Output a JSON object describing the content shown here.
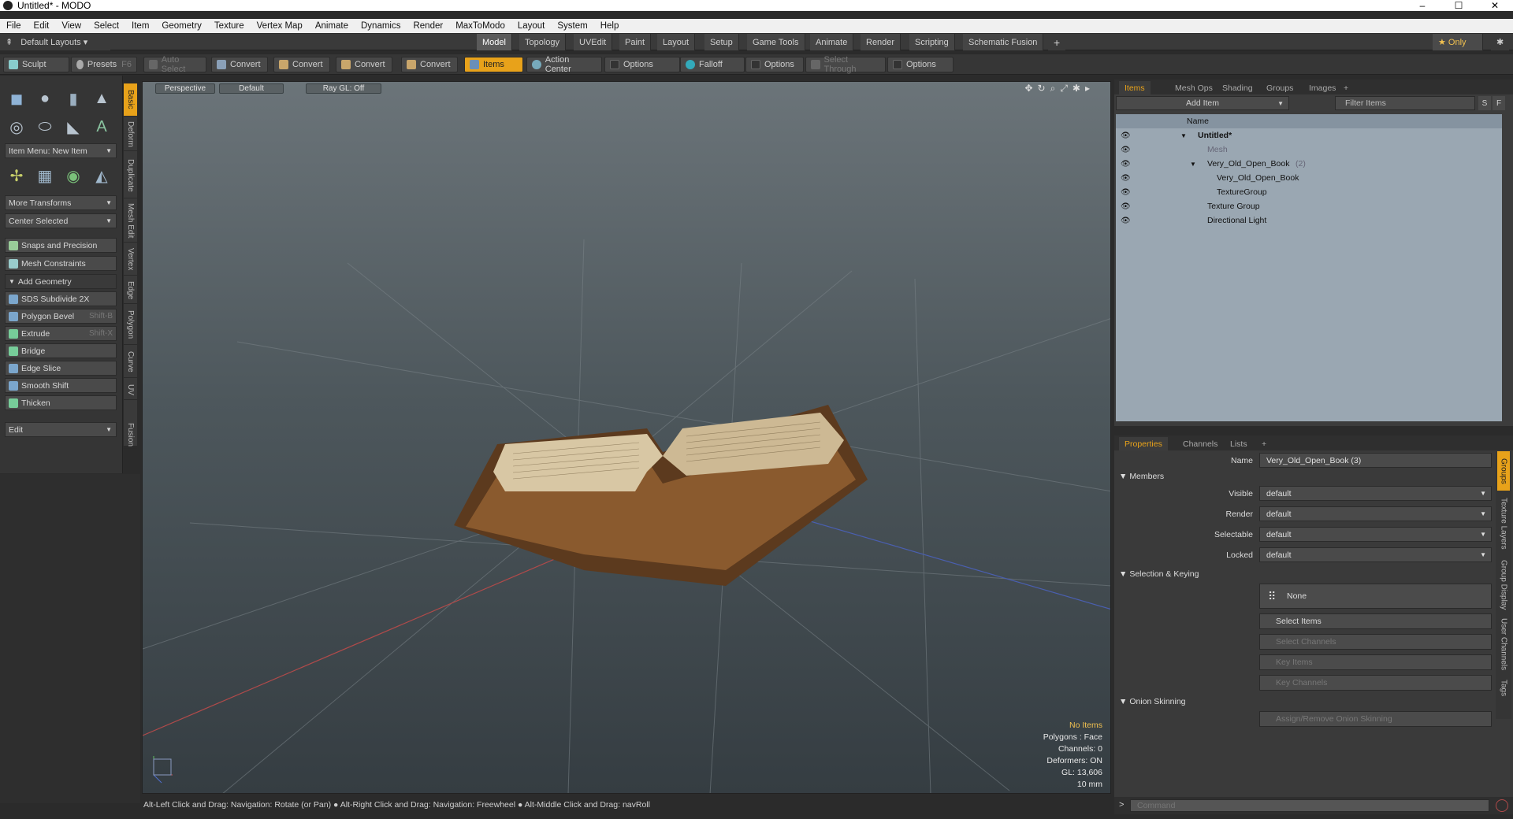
{
  "window": {
    "title": "Untitled* - MODO",
    "minimize": "–",
    "maximize": "☐",
    "close": "✕"
  },
  "menu": [
    "File",
    "Edit",
    "View",
    "Select",
    "Item",
    "Geometry",
    "Texture",
    "Vertex Map",
    "Animate",
    "Dynamics",
    "Render",
    "MaxToModo",
    "Layout",
    "System",
    "Help"
  ],
  "layoutbar": {
    "layouts": "Default Layouts ▾",
    "tabs": [
      "Model",
      "Topology",
      "UVEdit",
      "Paint",
      "Layout",
      "Setup",
      "Game Tools",
      "Animate",
      "Render",
      "Scripting",
      "Schematic Fusion"
    ],
    "active": "Model",
    "plus": "+",
    "only": "★ Only",
    "gear": "✱"
  },
  "toolbar": {
    "sculpt": "Sculpt",
    "presets": "Presets",
    "presets_key": "F6",
    "auto_select": "Auto Select",
    "convert": "Convert",
    "items": "Items",
    "action_center": "Action Center",
    "options": "Options",
    "falloff": "Falloff",
    "select_through": "Select Through"
  },
  "left": {
    "item_menu": "Item Menu: New Item",
    "more_transforms": "More Transforms",
    "center_selected": "Center Selected",
    "snaps": "Snaps and Precision",
    "mesh_constraints": "Mesh Constraints",
    "add_geometry": "Add Geometry",
    "sds": "SDS Subdivide 2X",
    "polygon_bevel": "Polygon Bevel",
    "polygon_bevel_key": "Shift-B",
    "extrude": "Extrude",
    "extrude_key": "Shift-X",
    "bridge": "Bridge",
    "edge_slice": "Edge Slice",
    "smooth_shift": "Smooth Shift",
    "thicken": "Thicken",
    "edit": "Edit"
  },
  "vtabs": [
    "Basic",
    "Deform",
    "Duplicate",
    "Mesh Edit",
    "Vertex",
    "Edge",
    "Polygon",
    "Curve",
    "UV",
    "Fusion"
  ],
  "viewport": {
    "perspective": "Perspective",
    "default": "Default",
    "raygl": "Ray GL: Off"
  },
  "stats": {
    "no_items": "No Items",
    "polygons": "Polygons : Face",
    "channels": "Channels: 0",
    "deformers": "Deformers: ON",
    "gl": "GL: 13,606",
    "scale": "10 mm"
  },
  "statusbar": "Alt-Left Click and Drag: Navigation: Rotate (or Pan) ● Alt-Right Click and Drag: Navigation: Freewheel ● Alt-Middle Click and Drag: navRoll",
  "items_panel": {
    "tabs": [
      "Items",
      "Mesh Ops",
      "Shading",
      "Groups",
      "Images"
    ],
    "add_item": "Add Item",
    "filter": "Filter Items",
    "s": "S",
    "f": "F",
    "name_header": "Name",
    "tree": [
      {
        "label": "Untitled*",
        "level": 0,
        "bold": true
      },
      {
        "label": "Mesh",
        "level": 1,
        "dim": true
      },
      {
        "label": "Very_Old_Open_Book",
        "suffix": "(2)",
        "level": 1
      },
      {
        "label": "Very_Old_Open_Book",
        "level": 2
      },
      {
        "label": "TextureGroup",
        "level": 2
      },
      {
        "label": "Texture Group",
        "level": 1
      },
      {
        "label": "Directional Light",
        "level": 1
      }
    ]
  },
  "props": {
    "tabs": [
      "Properties",
      "Channels",
      "Lists"
    ],
    "name_label": "Name",
    "name_value": "Very_Old_Open_Book (3)",
    "members": "Members",
    "visible": "Visible",
    "render": "Render",
    "selectable": "Selectable",
    "locked": "Locked",
    "default": "default",
    "selection_keying": "Selection & Keying",
    "none": "None",
    "select_items": "Select Items",
    "select_channels": "Select Channels",
    "key_items": "Key Items",
    "key_channels": "Key Channels",
    "onion": "Onion Skinning",
    "assign_onion": "Assign/Remove Onion Skinning"
  },
  "rvtabs": [
    "Groups",
    "Texture Layers",
    "Group Display",
    "User Channels",
    "Tags"
  ],
  "command_placeholder": "Command"
}
